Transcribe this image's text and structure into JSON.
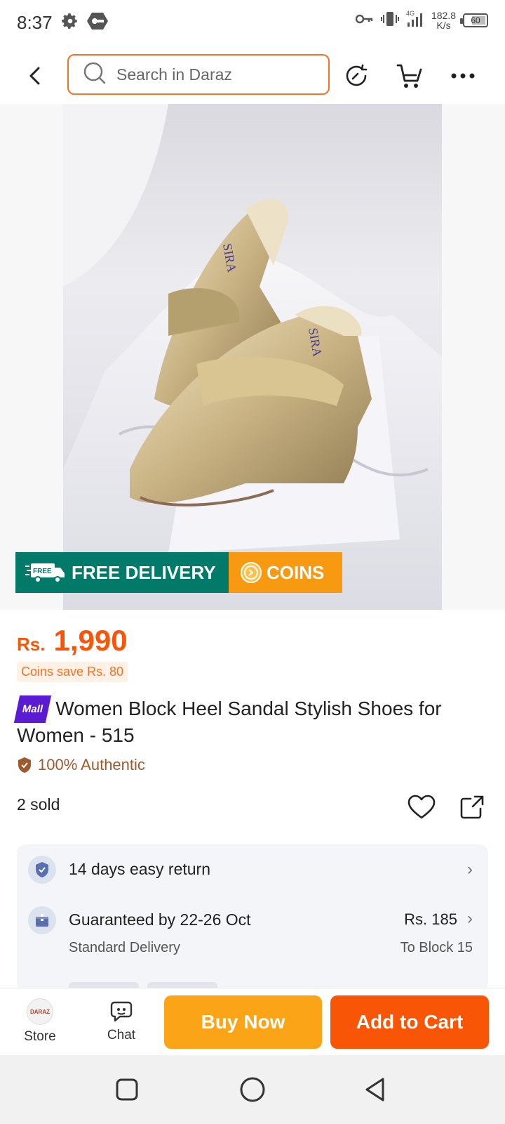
{
  "status_bar": {
    "time": "8:37",
    "network_type": "4G",
    "speed_value": "182.8",
    "speed_unit": "K/s",
    "battery": "60"
  },
  "header": {
    "search_placeholder": "Search in Daraz"
  },
  "product": {
    "image_alt": "Gold metallic block heel sandals",
    "badges": {
      "free_delivery": "FREE DELIVERY",
      "free_tag": "FREE",
      "coins": "COINS"
    },
    "price_currency": "Rs.",
    "price": "1,990",
    "coins_save": "Coins save Rs. 80",
    "mall_label": "Mall",
    "title": "Women Block Heel Sandal Stylish Shoes for Women - 515",
    "authentic": "100% Authentic",
    "sold": "2 sold"
  },
  "info_card": {
    "return": {
      "label": "14 days easy return"
    },
    "delivery": {
      "label": "Guaranteed by 22-26 Oct",
      "sub": "Standard Delivery",
      "price": "Rs. 185",
      "destination": "To Block 15"
    }
  },
  "action_bar": {
    "store_label": "Store",
    "store_logo_text": "DARAZ",
    "chat_label": "Chat",
    "buy_now": "Buy Now",
    "add_to_cart": "Add to Cart"
  },
  "colors": {
    "brand_orange": "#f85606",
    "search_border": "#f57224",
    "buy_now": "#fba418",
    "free_delivery": "#017a6a",
    "coins": "#f79a12",
    "mall": "#5b1bd2"
  }
}
